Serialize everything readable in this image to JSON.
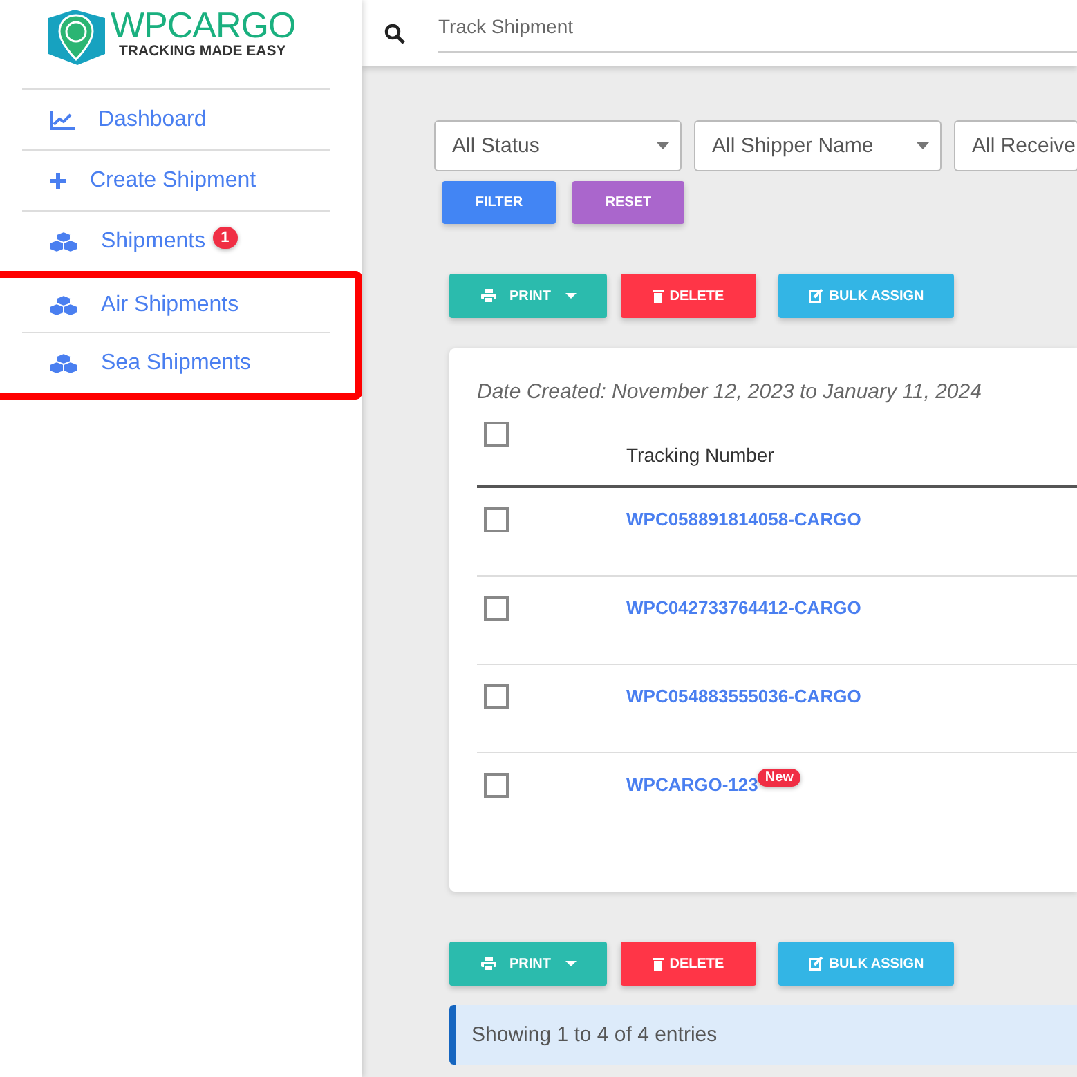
{
  "logo": {
    "title": "WPCARGO",
    "tagline": "TRACKING MADE EASY"
  },
  "sidebar": {
    "items": [
      {
        "label": "Dashboard",
        "kind": "chart",
        "highlighted": false
      },
      {
        "label": "Create Shipment",
        "kind": "plus",
        "highlighted": false
      },
      {
        "label": "Shipments",
        "kind": "boxes",
        "badge": "1",
        "highlighted": false
      },
      {
        "label": "Air Shipments",
        "kind": "boxes",
        "highlighted": true
      },
      {
        "label": "Sea Shipments",
        "kind": "boxes",
        "highlighted": true
      }
    ]
  },
  "search": {
    "placeholder": "Track Shipment"
  },
  "filters": [
    {
      "value": "All Status"
    },
    {
      "value": "All Shipper Name"
    },
    {
      "value": "All Receive"
    }
  ],
  "filter_buttons": [
    {
      "label": "FILTER",
      "kind": "filter"
    },
    {
      "label": "RESET",
      "kind": "reset"
    }
  ],
  "actions_top": [
    {
      "label": "PRINT",
      "kind": "print"
    },
    {
      "label": "DELETE",
      "kind": "delete"
    },
    {
      "label": "BULK ASSIGN",
      "kind": "assign"
    }
  ],
  "table": {
    "date_range": "Date Created: November 12, 2023 to January 11, 2024",
    "header": {
      "checked": false,
      "column": "Tracking Number"
    },
    "rows": [
      {
        "checked": false,
        "tracking": "WPC058891814058-CARGO"
      },
      {
        "checked": false,
        "tracking": "WPC042733764412-CARGO"
      },
      {
        "checked": false,
        "tracking": "WPC054883555036-CARGO"
      },
      {
        "checked": false,
        "tracking": "WPCARGO-123",
        "badge": "New"
      }
    ]
  },
  "actions_bottom": [
    {
      "label": "PRINT",
      "kind": "print"
    },
    {
      "label": "DELETE",
      "kind": "delete"
    },
    {
      "label": "BULK ASSIGN",
      "kind": "assign"
    }
  ],
  "info": "Showing 1 to 4 of 4 entries"
}
